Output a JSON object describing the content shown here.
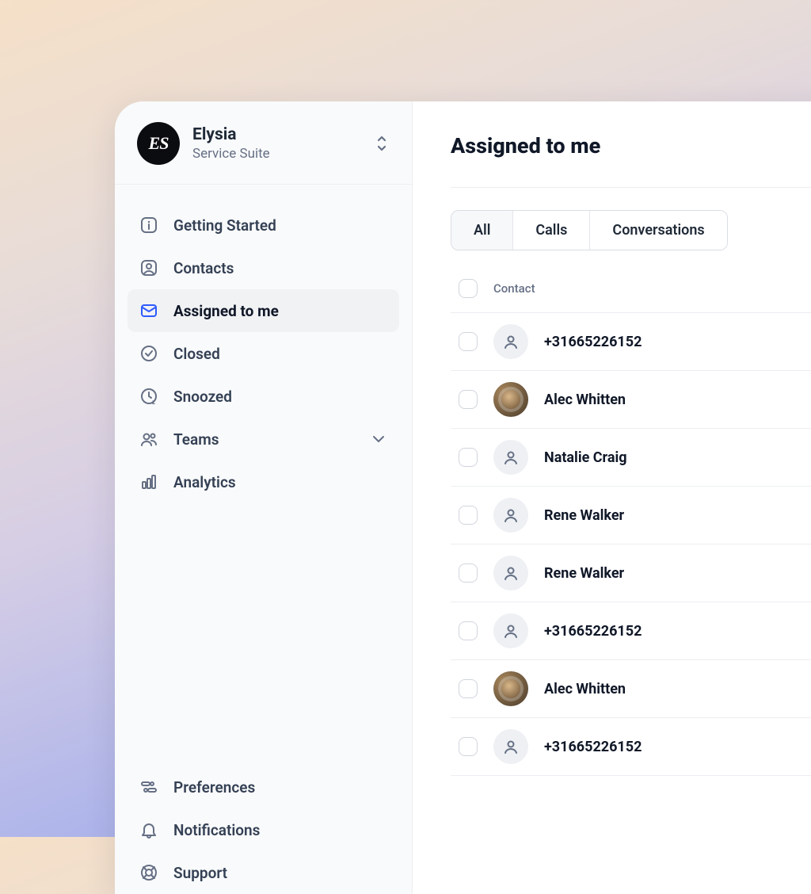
{
  "workspace": {
    "name": "Elysia",
    "subtitle": "Service Suite",
    "logo_text": "ES"
  },
  "sidebar": {
    "items": [
      {
        "key": "getting-started",
        "icon": "info",
        "label": "Getting Started",
        "active": false,
        "expandable": false
      },
      {
        "key": "contacts",
        "icon": "contact",
        "label": "Contacts",
        "active": false,
        "expandable": false
      },
      {
        "key": "assigned",
        "icon": "mail",
        "label": "Assigned to me",
        "active": true,
        "expandable": false
      },
      {
        "key": "closed",
        "icon": "check",
        "label": "Closed",
        "active": false,
        "expandable": false
      },
      {
        "key": "snoozed",
        "icon": "clock",
        "label": "Snoozed",
        "active": false,
        "expandable": false
      },
      {
        "key": "teams",
        "icon": "users",
        "label": "Teams",
        "active": false,
        "expandable": true
      },
      {
        "key": "analytics",
        "icon": "chart",
        "label": "Analytics",
        "active": false,
        "expandable": false
      }
    ],
    "footer_items": [
      {
        "key": "preferences",
        "icon": "sliders",
        "label": "Preferences"
      },
      {
        "key": "notifications",
        "icon": "bell",
        "label": "Notifications"
      },
      {
        "key": "support",
        "icon": "lifebuoy",
        "label": "Support"
      }
    ]
  },
  "main": {
    "title": "Assigned to me",
    "tabs": [
      {
        "key": "all",
        "label": "All",
        "active": true
      },
      {
        "key": "calls",
        "label": "Calls",
        "active": false
      },
      {
        "key": "conv",
        "label": "Conversations",
        "active": false
      }
    ],
    "table": {
      "header": {
        "contact": "Contact"
      },
      "rows": [
        {
          "name": "+31665226152",
          "has_photo": false
        },
        {
          "name": "Alec Whitten",
          "has_photo": true
        },
        {
          "name": "Natalie Craig",
          "has_photo": false
        },
        {
          "name": "Rene Walker",
          "has_photo": false
        },
        {
          "name": "Rene Walker",
          "has_photo": false
        },
        {
          "name": "+31665226152",
          "has_photo": false
        },
        {
          "name": "Alec Whitten",
          "has_photo": true
        },
        {
          "name": "+31665226152",
          "has_photo": false
        }
      ]
    }
  }
}
